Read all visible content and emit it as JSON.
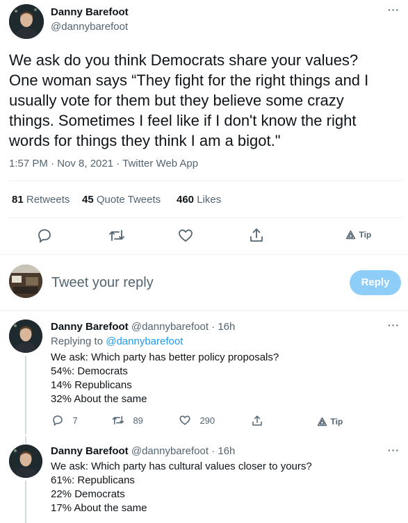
{
  "main_tweet": {
    "author_name": "Danny Barefoot",
    "author_handle": "@dannybarefoot",
    "text_lines": [
      "We ask do you think Democrats share your values?",
      "One woman says “They fight for the right things and I",
      "usually vote for them but they believe some crazy",
      "things. Sometimes I feel like if I don't know the right",
      "words for things they think I am a bigot.\""
    ],
    "meta": "1:57 PM · Nov 8, 2021 · Twitter Web App",
    "stats": {
      "retweets_count": "81",
      "retweets_label": "Retweets",
      "quotes_count": "45",
      "quotes_label": "Quote Tweets",
      "likes_count": "460",
      "likes_label": "Likes"
    },
    "tip_label": "Tip"
  },
  "reply_box": {
    "placeholder": "Tweet your reply",
    "button_label": "Reply"
  },
  "replies": [
    {
      "author_name": "Danny Barefoot",
      "author_handle": "@dannybarefoot",
      "time": "· 16h",
      "replying_label": "Replying to",
      "replying_handle": "@dannybarefoot",
      "lines": [
        "We ask: Which party has better policy proposals?",
        "54%: Democrats",
        "14% Republicans",
        "32% About the same"
      ],
      "reply_count": "7",
      "retweet_count": "89",
      "like_count": "290",
      "tip_label": "Tip"
    },
    {
      "author_name": "Danny Barefoot",
      "author_handle": "@dannybarefoot",
      "time": "· 16h",
      "lines": [
        "We ask: Which party has cultural values closer to yours?",
        "61%: Republicans",
        "22% Democrats",
        "17% About the same"
      ]
    }
  ],
  "more_glyph": "···"
}
